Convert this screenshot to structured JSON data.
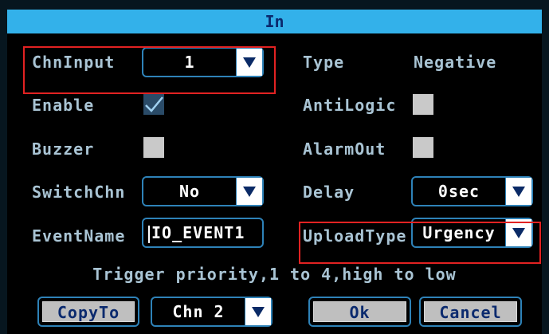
{
  "dialog": {
    "title": "In",
    "chn_input": {
      "label": "ChnInput",
      "value": "1"
    },
    "type": {
      "label": "Type",
      "value": "Negative"
    },
    "enable": {
      "label": "Enable",
      "checked": true
    },
    "anti_logic": {
      "label": "AntiLogic",
      "checked": false
    },
    "buzzer": {
      "label": "Buzzer",
      "checked": false
    },
    "alarm_out": {
      "label": "AlarmOut",
      "checked": false
    },
    "switch_chn": {
      "label": "SwitchChn",
      "value": "No"
    },
    "delay": {
      "label": "Delay",
      "value": "0sec"
    },
    "event_name": {
      "label": "EventName",
      "value": "IO_EVENT1"
    },
    "upload_type": {
      "label": "UploadType",
      "value": "Urgency"
    },
    "hint": "Trigger priority,1 to 4,high to low",
    "footer": {
      "copy_to_label": "CopyTo",
      "copy_chn_value": "Chn 2",
      "ok_label": "Ok",
      "cancel_label": "Cancel"
    }
  },
  "colors": {
    "title_bar": "#33b1ea",
    "frame_border": "#2e82b8",
    "label_text": "#a9c4d4",
    "highlight_box": "#e22222"
  }
}
